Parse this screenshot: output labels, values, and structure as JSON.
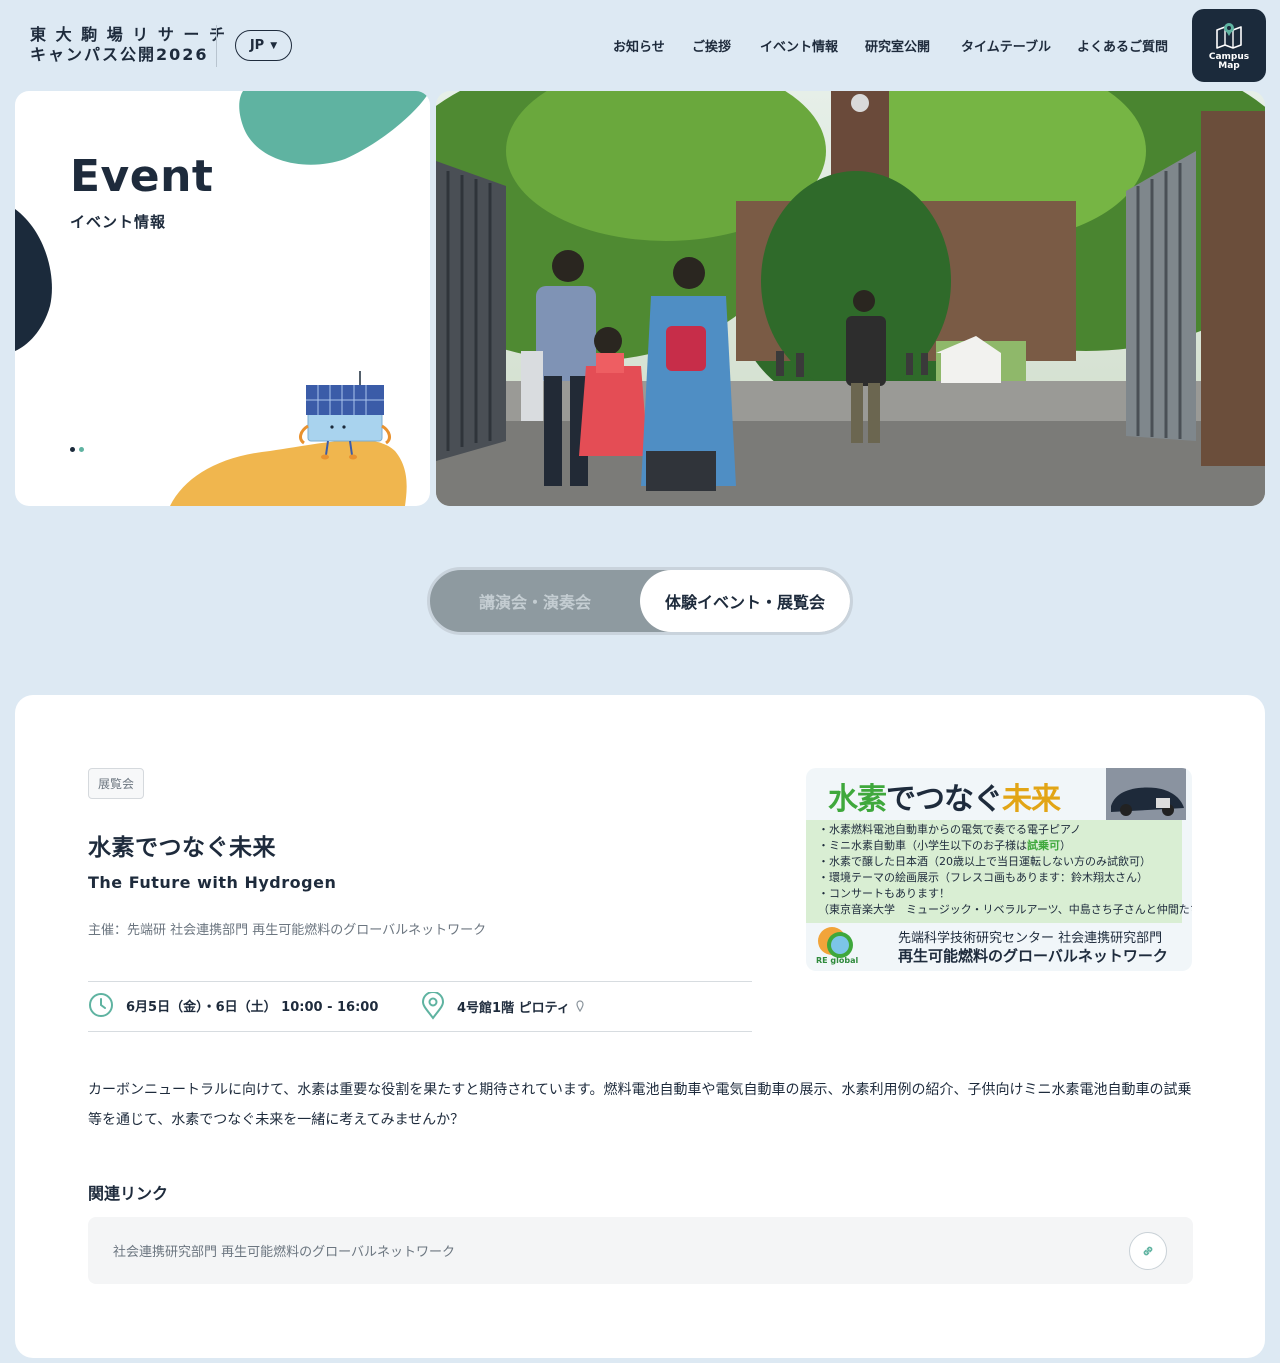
{
  "header": {
    "site_title_line1": "東 大 駒 場 リ サ ー チ",
    "site_title_line2": "キャンパス公開2026",
    "lang": "JP",
    "nav": [
      "お知らせ",
      "ご挨拶",
      "イベント情報",
      "研究室公開",
      "タイムテーブル",
      "よくあるご質問"
    ],
    "map_button": [
      "Campus",
      "Map"
    ]
  },
  "hero": {
    "title": "Event",
    "subtitle": "イベント情報"
  },
  "tabs": {
    "inactive": "講演会・演奏会",
    "active": "体験イベント・展覧会"
  },
  "event": {
    "tag": "展覧会",
    "title": "水素でつなぐ未来",
    "title_en": "The Future with Hydrogen",
    "organizer": "主催：先端研 社会連携部門 再生可能燃料のグローバルネットワーク",
    "date": "6月5日（金）・6日（土） 10:00 - 16:00",
    "place": "4号館1階 ピロティ",
    "description": "カーボンニュートラルに向けて、水素は重要な役割を果たすと期待されています。燃料電池自動車や電気自動車の展示、水素利用例の紹介、子供向けミニ水素電池自動車の試乗等を通じて、水素でつなぐ未来を一緒に考えてみませんか？",
    "links_heading": "関連リンク",
    "link_text": "社会連携研究部門 再生可能燃料のグローバルネットワーク"
  },
  "flyer": {
    "head_green": "水素",
    "head_mid": "でつなぐ",
    "head_yellow": "未来",
    "items": [
      "・水素燃料電池自動車からの電気で奏でる電子ピアノ",
      "・ミニ水素自動車（小学生以下のお子様は",
      "・水素で醸した日本酒（20歳以上で当日運転しない方のみ試飲可）",
      "・環境テーマの絵画展示（フレスコ画もあります：鈴木翔太さん）",
      "・コンサートもあります！",
      "（東京音楽大学　ミュージック・リベラルアーツ、中島さち子さんと仲間たち）"
    ],
    "item2_green": "試乗可",
    "item2_end": "）",
    "foot1": "先端科学技術研究センター 社会連携研究部門",
    "foot2": "再生可能燃料のグローバルネットワーク",
    "logo_text": "RE global"
  },
  "colors": {
    "background": "#dde9f3",
    "navy": "#1b2a3b",
    "teal": "#5fb3a1",
    "yellow": "#f0b64e",
    "tab_inactive": "#8e9aa0"
  },
  "icons": {
    "map": "map-icon",
    "clock": "clock-icon",
    "pin": "location-pin-icon",
    "link": "link-icon"
  }
}
